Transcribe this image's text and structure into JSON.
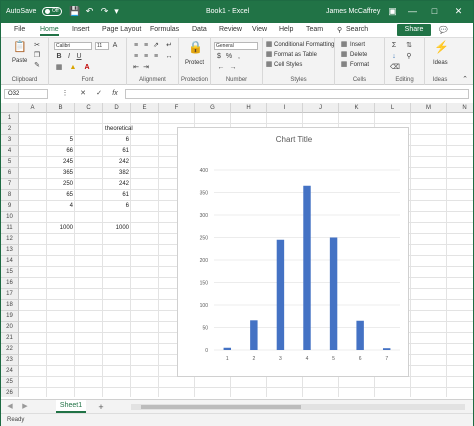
{
  "titlebar": {
    "autosave_label": "AutoSave",
    "autosave_state": "Off",
    "doc_title": "Book1 - Excel",
    "user": "James McCaffrey"
  },
  "menu": {
    "tabs": [
      "File",
      "Home",
      "Insert",
      "Page Layout",
      "Formulas",
      "Data",
      "Review",
      "View",
      "Help",
      "Team"
    ],
    "active": "Home",
    "search_label": "Search",
    "share_label": "Share"
  },
  "ribbon": {
    "clipboard": {
      "paste": "Paste",
      "label": "Clipboard"
    },
    "font": {
      "name": "Calibri",
      "size": "11",
      "label": "Font"
    },
    "alignment": {
      "label": "Alignment"
    },
    "protection": {
      "protect": "Protect",
      "label": "Protection"
    },
    "number": {
      "format": "General",
      "label": "Number"
    },
    "styles": {
      "conditional": "Conditional Formatting",
      "format_table": "Format as Table",
      "cell_styles": "Cell Styles",
      "label": "Styles"
    },
    "cells": {
      "insert": "Insert",
      "delete": "Delete",
      "format": "Format",
      "label": "Cells"
    },
    "editing": {
      "label": "Editing"
    },
    "ideas": {
      "button": "Ideas",
      "label": "Ideas"
    }
  },
  "formula_bar": {
    "name_box": "O32",
    "fx": "fx",
    "formula": ""
  },
  "columns": [
    "A",
    "B",
    "C",
    "D",
    "E",
    "F",
    "G",
    "H",
    "I",
    "J",
    "K",
    "L",
    "M",
    "N"
  ],
  "rows": [
    "1",
    "2",
    "3",
    "4",
    "5",
    "6",
    "7",
    "8",
    "9",
    "10",
    "11",
    "12",
    "13",
    "14",
    "15",
    "16",
    "17",
    "18",
    "19",
    "20",
    "21",
    "22",
    "23",
    "24",
    "25",
    "26"
  ],
  "cells": {
    "d2": "theoretical",
    "b3": "5",
    "d3": "6",
    "b4": "66",
    "d4": "61",
    "b5": "245",
    "d5": "242",
    "b6": "365",
    "d6": "382",
    "b7": "250",
    "d7": "242",
    "b8": "65",
    "d8": "61",
    "b9": "4",
    "d9": "6",
    "b11": "1000",
    "d11": "1000"
  },
  "chart_data": {
    "type": "bar",
    "title": "Chart Title",
    "categories": [
      "1",
      "2",
      "3",
      "4",
      "5",
      "6",
      "7"
    ],
    "values": [
      5,
      66,
      245,
      365,
      250,
      65,
      4
    ],
    "ylim": [
      0,
      400
    ],
    "yticks": [
      0,
      50,
      100,
      150,
      200,
      250,
      300,
      350,
      400
    ],
    "grid": true,
    "bar_color": "#4472c4"
  },
  "sheets": {
    "tabs": [
      "Sheet1"
    ],
    "active": "Sheet1",
    "add_symbol": "+"
  },
  "status": {
    "text": "Ready"
  },
  "colors": {
    "excel_green": "#217346",
    "bar": "#4472c4"
  }
}
